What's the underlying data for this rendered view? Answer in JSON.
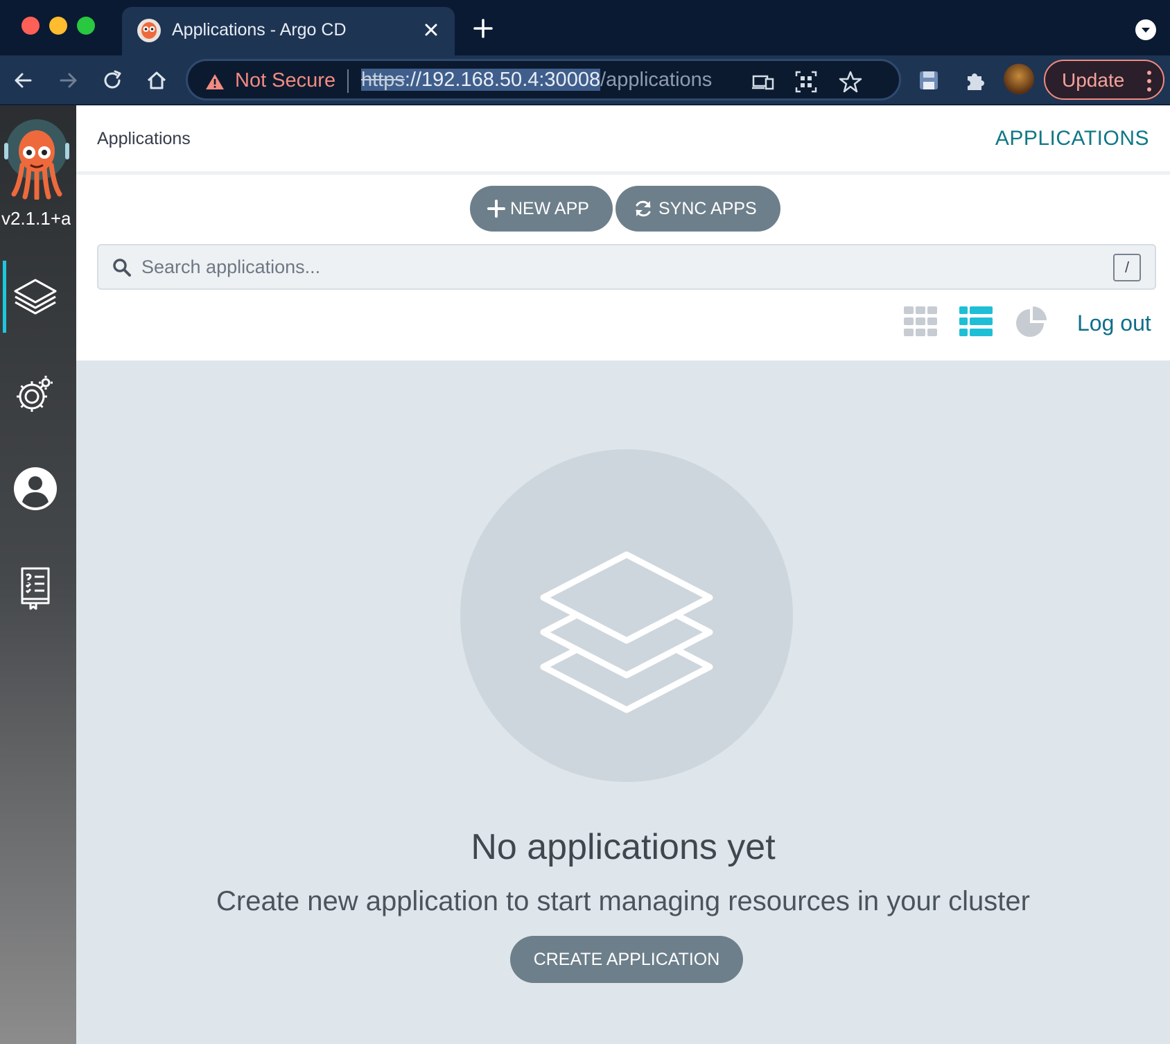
{
  "browser": {
    "tab_title": "Applications - Argo CD",
    "security_label": "Not Secure",
    "url_scheme": "https",
    "url_host_rest": "://192.168.50.4:30008",
    "url_path": "/applications",
    "update_label": "Update"
  },
  "sidebar": {
    "version": "v2.1.1+a",
    "items": [
      {
        "icon": "layers-icon",
        "active": true
      },
      {
        "icon": "settings-gear-icon",
        "active": false
      },
      {
        "icon": "user-icon",
        "active": false
      },
      {
        "icon": "docs-book-icon",
        "active": false
      }
    ]
  },
  "header": {
    "breadcrumb": "Applications",
    "page_title": "APPLICATIONS"
  },
  "toolbar": {
    "new_app_label": "NEW APP",
    "sync_apps_label": "SYNC APPS",
    "search_placeholder": "Search applications...",
    "search_shortcut": "/",
    "views": [
      "tiles-view-icon",
      "list-view-icon",
      "summary-pie-icon"
    ],
    "active_view": "list",
    "logout_label": "Log out"
  },
  "empty_state": {
    "title": "No applications yet",
    "subtitle": "Create new application to start managing resources in your cluster",
    "button_label": "CREATE APPLICATION"
  },
  "colors": {
    "accent": "#1ec7dd",
    "title_teal": "#0e7886",
    "button_gray": "#6d7f8b",
    "warning_red": "#f28b82"
  }
}
